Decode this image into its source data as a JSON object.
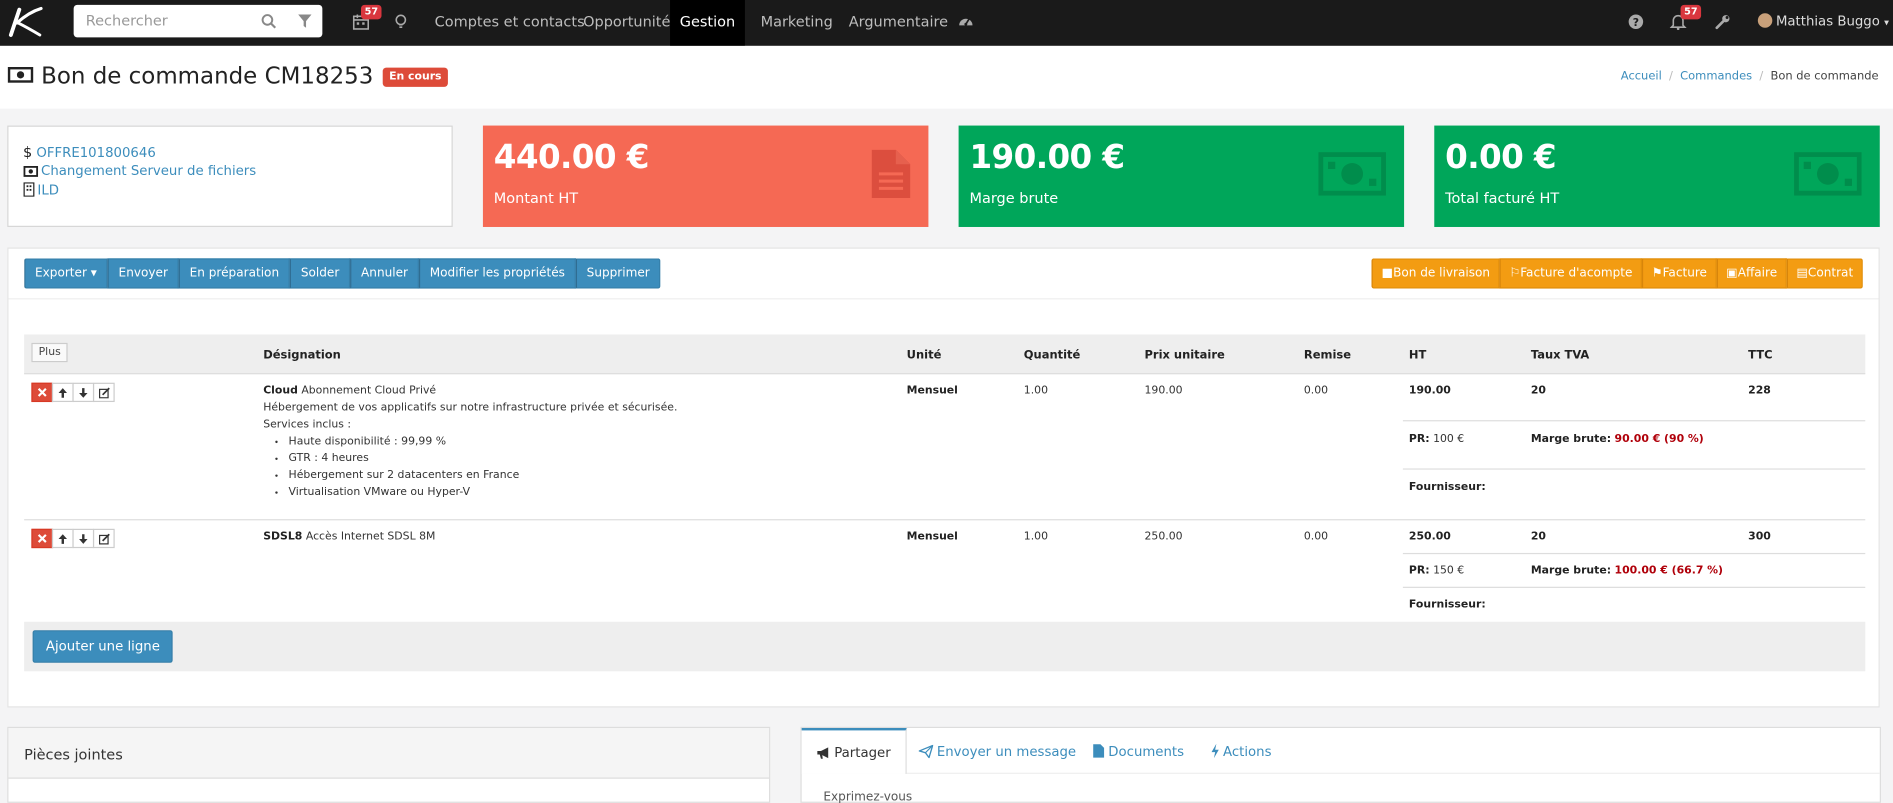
{
  "nav": {
    "search_placeholder": "Rechercher",
    "calendar_badge": "57",
    "bell_badge": "57",
    "items": [
      "Comptes et contacts",
      "Opportunité",
      "Gestion",
      "Marketing",
      "Argumentaire"
    ],
    "active": "Gestion",
    "user": "Matthias Buggo"
  },
  "header": {
    "title": "Bon de commande CM18253",
    "status": "En cours",
    "breadcrumb": [
      "Accueil",
      "Commandes",
      "Bon de commande"
    ]
  },
  "info": {
    "offer": "OFFRE101800646",
    "project": "Changement Serveur de fichiers",
    "company": "ILD"
  },
  "kpis": [
    {
      "value": "440.00 €",
      "label": "Montant HT",
      "color": "#f56954",
      "icon": "document-icon"
    },
    {
      "value": "190.00 €",
      "label": "Marge brute",
      "color": "#00a65a",
      "icon": "money-icon"
    },
    {
      "value": "0.00 €",
      "label": "Total facturé HT",
      "color": "#00a65a",
      "icon": "money-icon"
    }
  ],
  "actions": {
    "left": [
      "Exporter",
      "Envoyer",
      "En préparation",
      "Solder",
      "Annuler",
      "Modifier les propriétés",
      "Supprimer"
    ],
    "right": [
      "Bon de livraison",
      "Facture d'acompte",
      "Facture",
      "Affaire",
      "Contrat"
    ]
  },
  "table": {
    "plus_label": "Plus",
    "headers": [
      "Désignation",
      "Unité",
      "Quantité",
      "Prix unitaire",
      "Remise",
      "HT",
      "Taux TVA",
      "TTC"
    ],
    "pr_label": "PR:",
    "margin_label": "Marge brute:",
    "supplier_label": "Fournisseur:",
    "rows": [
      {
        "code": "Cloud",
        "name": "Abonnement Cloud Privé",
        "desc": "Hébergement de vos applicatifs sur notre infrastructure privée et sécurisée.",
        "services_title": "Services inclus :",
        "services": [
          "Haute disponibilité : 99,99 %",
          "GTR : 4 heures",
          "Hébergement sur 2 datacenters en France",
          "Virtualisation VMware ou Hyper-V"
        ],
        "unit": "Mensuel",
        "qty": "1.00",
        "price": "190.00",
        "discount": "0.00",
        "ht": "190.00",
        "vat": "20",
        "ttc": "228",
        "pr": "100 €",
        "margin": "90.00 € (90 %)"
      },
      {
        "code": "SDSL8",
        "name": "Accès Internet SDSL 8M",
        "unit": "Mensuel",
        "qty": "1.00",
        "price": "250.00",
        "discount": "0.00",
        "ht": "250.00",
        "vat": "20",
        "ttc": "300",
        "pr": "150 €",
        "margin": "100.00 € (66.7 %)"
      }
    ],
    "add_line": "Ajouter une ligne"
  },
  "attachments": {
    "title": "Pièces jointes"
  },
  "share": {
    "tabs": [
      "Partager",
      "Envoyer un message",
      "Documents",
      "Actions"
    ],
    "active": "Partager",
    "prompt": "Exprimez-vous"
  }
}
